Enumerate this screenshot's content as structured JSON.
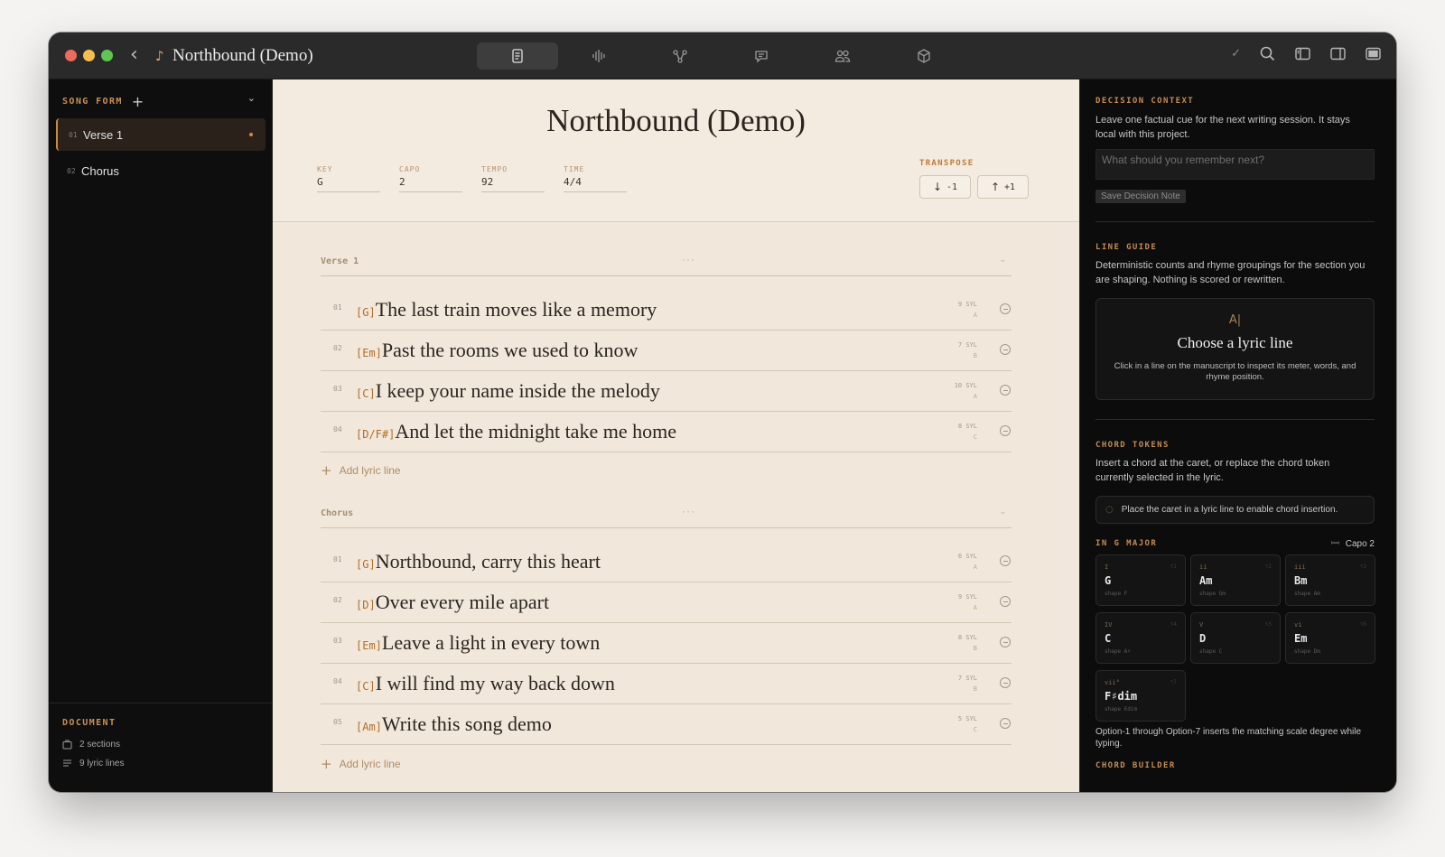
{
  "window": {
    "title": "Northbound (Demo)"
  },
  "toolbar": {
    "tabs": [
      {
        "icon": "manuscript-icon",
        "active": true
      },
      {
        "icon": "waveform-icon",
        "active": false
      },
      {
        "icon": "structure-icon",
        "active": false
      },
      {
        "icon": "comment-icon",
        "active": false
      },
      {
        "icon": "collaborators-icon",
        "active": false
      },
      {
        "icon": "package-icon",
        "active": false
      }
    ],
    "check": "✓"
  },
  "sidebar": {
    "header": "SONG FORM",
    "items": [
      {
        "num": "01",
        "name": "Verse 1",
        "active": true
      },
      {
        "num": "02",
        "name": "Chorus",
        "active": false
      }
    ],
    "document": {
      "title": "DOCUMENT",
      "sections": "2 sections",
      "lines": "9 lyric lines"
    }
  },
  "song": {
    "title": "Northbound (Demo)",
    "meta": [
      {
        "label": "KEY",
        "value": "G"
      },
      {
        "label": "CAPO",
        "value": "2"
      },
      {
        "label": "TEMPO",
        "value": "92"
      },
      {
        "label": "TIME",
        "value": "4/4"
      }
    ],
    "transpose": {
      "label": "TRANSPOSE",
      "down": "-1",
      "up": "+1"
    }
  },
  "sections": [
    {
      "name": "Verse 1",
      "lines": [
        {
          "num": "01",
          "chord": "[G]",
          "text": "The last train moves like a memory",
          "syl": "9 SYL",
          "rhyme": "A"
        },
        {
          "num": "02",
          "chord": "[Em]",
          "text": "Past the rooms we used to know",
          "syl": "7 SYL",
          "rhyme": "B"
        },
        {
          "num": "03",
          "chord": "[C]",
          "text": "I keep your name inside the melody",
          "syl": "10 SYL",
          "rhyme": "A"
        },
        {
          "num": "04",
          "chord": "[D/F#]",
          "text": "And let the midnight take me home",
          "syl": "8 SYL",
          "rhyme": "C"
        }
      ],
      "add_label": "Add lyric line"
    },
    {
      "name": "Chorus",
      "lines": [
        {
          "num": "01",
          "chord": "[G]",
          "text": "Northbound, carry this heart",
          "syl": "6 SYL",
          "rhyme": "A"
        },
        {
          "num": "02",
          "chord": "[D]",
          "text": "Over every mile apart",
          "syl": "9 SYL",
          "rhyme": "A"
        },
        {
          "num": "03",
          "chord": "[Em]",
          "text": "Leave a light in every town",
          "syl": "8 SYL",
          "rhyme": "B"
        },
        {
          "num": "04",
          "chord": "[C]",
          "text": "I will find my way back down",
          "syl": "7 SYL",
          "rhyme": "B"
        },
        {
          "num": "05",
          "chord": "[Am]",
          "text": "Write this song demo",
          "syl": "5 SYL",
          "rhyme": "C"
        }
      ],
      "add_label": "Add lyric line"
    }
  ],
  "inspector": {
    "decision": {
      "title": "DECISION CONTEXT",
      "desc": "Leave one factual cue for the next writing session. It stays local with this project.",
      "placeholder": "What should you remember next?",
      "save": "Save Decision Note"
    },
    "guide": {
      "title": "LINE GUIDE",
      "desc": "Deterministic counts and rhyme groupings for the section you are shaping. Nothing is scored or rewritten.",
      "card_title": "Choose a lyric line",
      "card_desc": "Click in a line on the manuscript to inspect its meter, words, and rhyme position."
    },
    "chords": {
      "title": "CHORD TOKENS",
      "desc": "Insert a chord at the caret, or replace the chord token currently selected in the lyric.",
      "hint": "Place the caret in a lyric line to enable chord insertion.",
      "scale_title": "IN G MAJOR",
      "capo": "Capo 2",
      "cards": [
        {
          "degree": "I",
          "key": "⌥1",
          "name": "G",
          "shape": "shape F"
        },
        {
          "degree": "ii",
          "key": "⌥2",
          "name": "Am",
          "shape": "shape Gm"
        },
        {
          "degree": "iii",
          "key": "⌥3",
          "name": "Bm",
          "shape": "shape Am"
        },
        {
          "degree": "IV",
          "key": "⌥4",
          "name": "C",
          "shape": "shape A♯"
        },
        {
          "degree": "V",
          "key": "⌥5",
          "name": "D",
          "shape": "shape C"
        },
        {
          "degree": "vi",
          "key": "⌥6",
          "name": "Em",
          "shape": "shape Dm"
        },
        {
          "degree": "vii°",
          "key": "⌥7",
          "name": "F♯dim",
          "shape": "shape Edim"
        }
      ],
      "footnote": "Option-1 through Option-7 inserts the matching scale degree while typing.",
      "builder_title": "CHORD BUILDER"
    }
  },
  "colors": {
    "accent": "#c98a47",
    "chord": "#b16d2b",
    "paper": "#f1e8db",
    "dark": "#0e0e0e"
  }
}
